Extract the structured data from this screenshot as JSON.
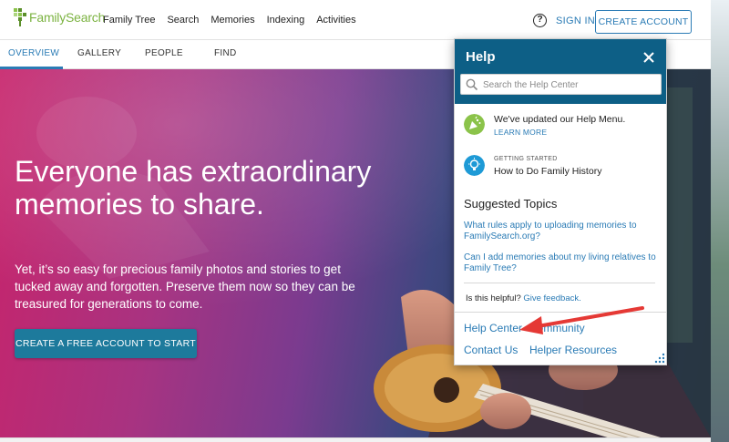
{
  "header": {
    "logo_text": "FamilySearch",
    "nav": [
      "Family Tree",
      "Search",
      "Memories",
      "Indexing",
      "Activities"
    ],
    "help_icon": "?",
    "sign_in": "SIGN IN",
    "create_account": "CREATE ACCOUNT"
  },
  "subtabs": {
    "overview": "OVERVIEW",
    "gallery": "GALLERY",
    "people": "PEOPLE",
    "find": "FIND"
  },
  "hero": {
    "title": "Everyone has extraordinary memories to share.",
    "subtitle": "Yet, it’s so easy for precious family photos and stories to get tucked away and forgotten. Preserve them now so they can be treasured for generations to come.",
    "cta": "CREATE A FREE ACCOUNT TO START"
  },
  "help_panel": {
    "title": "Help",
    "search_placeholder": "Search the Help Center",
    "notice1": {
      "text": "We've updated our Help Menu.",
      "link": "LEARN MORE"
    },
    "notice2": {
      "eyebrow": "GETTING STARTED",
      "text": "How to Do Family History"
    },
    "suggested_title": "Suggested Topics",
    "topics": [
      "What rules apply to uploading memories to FamilySearch.org?",
      "Can I add memories about my living relatives to Family Tree?"
    ],
    "helpful_text": "Is this helpful?",
    "feedback_link": "Give feedback.",
    "footer": {
      "help_center": "Help Center",
      "community": "Community",
      "contact_us": "Contact Us",
      "helper_resources": "Helper Resources"
    }
  },
  "colors": {
    "brand_green": "#7cb342",
    "link_blue": "#2a7bb5",
    "help_header": "#0d5f86",
    "cta_teal": "#1d7a9c",
    "annotation_red": "#e53935"
  }
}
